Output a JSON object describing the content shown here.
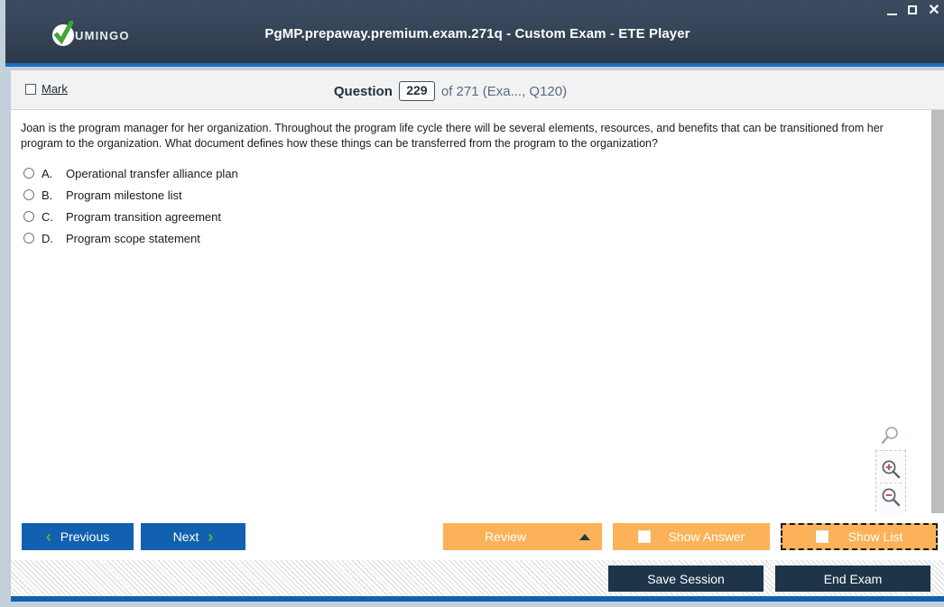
{
  "window": {
    "title": "PgMP.prepaway.premium.exam.271q - Custom Exam - ETE Player",
    "logo_text": "UMINGO",
    "controls": {
      "minimize": "—",
      "maximize": "□",
      "close": "✕"
    },
    "colors": {
      "titlebar": "#37465a",
      "accent_blue": "#1161b0",
      "accent_orange": "#fbb258",
      "chevron_green": "#5cb634",
      "dark_button": "#1d3449"
    }
  },
  "header": {
    "mark_label": "Mark",
    "mark_checked": false,
    "question_label": "Question",
    "question_number": "229",
    "question_of": "of 271 (Exa..., Q120)"
  },
  "question": {
    "text": "Joan is the program manager for her organization. Throughout the program life cycle there will be several elements, resources, and benefits that can be transitioned from her program to the organization. What document defines how these things can be transferred from the program to the organization?",
    "options": [
      {
        "letter": "A.",
        "text": "Operational transfer alliance plan",
        "selected": false
      },
      {
        "letter": "B.",
        "text": "Program milestone list",
        "selected": false
      },
      {
        "letter": "C.",
        "text": "Program transition agreement",
        "selected": false
      },
      {
        "letter": "D.",
        "text": "Program scope statement",
        "selected": false
      }
    ]
  },
  "zoom_tools": {
    "reset_icon": "magnifier-icon",
    "zoom_in_icon": "zoom-in-icon",
    "zoom_out_icon": "zoom-out-icon"
  },
  "toolbar": {
    "previous_label": "Previous",
    "next_label": "Next",
    "review_label": "Review",
    "show_answer_label": "Show Answer",
    "show_list_label": "Show List"
  },
  "footer": {
    "save_session_label": "Save Session",
    "end_exam_label": "End Exam"
  }
}
